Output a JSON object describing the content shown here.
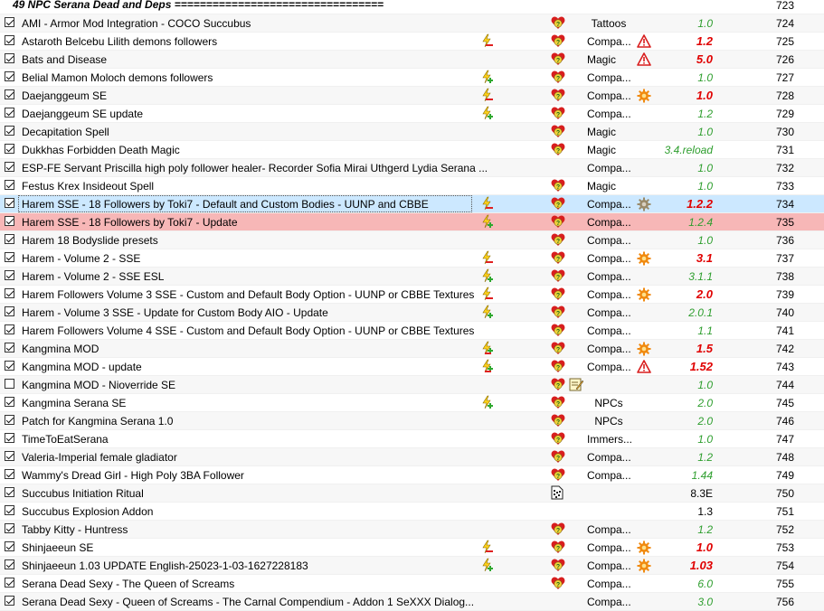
{
  "separator": {
    "label": "49 NPC Serana Dead and Deps =================================",
    "priority": "723"
  },
  "rows": [
    {
      "name": "AMI - Armor Mod Integration - COCO Succubus",
      "checked": true,
      "flag": "",
      "heart": true,
      "cat": "Tattoos",
      "catCenter": true,
      "warn": "",
      "ver": "1.0",
      "verStyle": "ok",
      "prio": "724"
    },
    {
      "name": "Astaroth Belcebu Lilith demons followers",
      "checked": true,
      "flag": "lightning-red",
      "heart": true,
      "cat": "Compa...",
      "warn": "warning",
      "ver": "1.2",
      "verStyle": "bad",
      "prio": "725"
    },
    {
      "name": "Bats and Disease",
      "checked": true,
      "flag": "",
      "heart": true,
      "cat": "Magic",
      "warn": "warning",
      "ver": "5.0",
      "verStyle": "bad",
      "prio": "726"
    },
    {
      "name": "Belial Mamon Moloch demons followers",
      "checked": true,
      "flag": "lightning-green",
      "heart": true,
      "cat": "Compa...",
      "warn": "",
      "ver": "1.0",
      "verStyle": "ok",
      "prio": "727"
    },
    {
      "name": "Daejanggeum SE",
      "checked": true,
      "flag": "lightning-red",
      "heart": true,
      "cat": "Compa...",
      "warn": "gear",
      "ver": "1.0",
      "verStyle": "bad",
      "prio": "728"
    },
    {
      "name": "Daejanggeum SE update",
      "checked": true,
      "flag": "lightning-green",
      "heart": true,
      "cat": "Compa...",
      "warn": "",
      "ver": "1.2",
      "verStyle": "ok",
      "prio": "729"
    },
    {
      "name": "Decapitation Spell",
      "checked": true,
      "flag": "",
      "heart": true,
      "cat": "Magic",
      "warn": "",
      "ver": "1.0",
      "verStyle": "ok",
      "prio": "730"
    },
    {
      "name": "Dukkhas Forbidden Death Magic",
      "checked": true,
      "flag": "",
      "heart": true,
      "cat": "Magic",
      "warn": "",
      "ver": "3.4.reload",
      "verStyle": "ok",
      "prio": "731"
    },
    {
      "name": "ESP-FE Servant Priscilla high poly follower healer- Recorder Sofia Mirai Uthgerd Lydia Serana ...",
      "checked": true,
      "flag": "",
      "heart": false,
      "cat": "Compa...",
      "warn": "",
      "ver": "1.0",
      "verStyle": "ok",
      "prio": "732"
    },
    {
      "name": "Festus Krex Insideout Spell",
      "checked": true,
      "flag": "",
      "heart": true,
      "cat": "Magic",
      "warn": "",
      "ver": "1.0",
      "verStyle": "ok",
      "prio": "733"
    },
    {
      "name": "Harem SSE - 18 Followers by Toki7 - Default and Custom Bodies - UUNP and CBBE",
      "checked": true,
      "flag": "lightning-red",
      "heart": true,
      "cat": "Compa...",
      "warn": "gear-gray",
      "ver": "1.2.2",
      "verStyle": "bad",
      "prio": "734",
      "state": "selected"
    },
    {
      "name": "Harem SSE - 18 Followers by Toki7 - Update",
      "checked": true,
      "flag": "lightning-green",
      "heart": true,
      "cat": "Compa...",
      "warn": "",
      "ver": "1.2.4",
      "verStyle": "ok",
      "prio": "735",
      "state": "conflict"
    },
    {
      "name": "Harem 18 Bodyslide presets",
      "checked": true,
      "flag": "",
      "heart": true,
      "cat": "Compa...",
      "warn": "",
      "ver": "1.0",
      "verStyle": "ok",
      "prio": "736"
    },
    {
      "name": "Harem - Volume 2 - SSE",
      "checked": true,
      "flag": "lightning-red",
      "heart": true,
      "cat": "Compa...",
      "warn": "gear",
      "ver": "3.1",
      "verStyle": "bad",
      "prio": "737"
    },
    {
      "name": "Harem - Volume 2 - SSE ESL",
      "checked": true,
      "flag": "lightning-green",
      "heart": true,
      "cat": "Compa...",
      "warn": "",
      "ver": "3.1.1",
      "verStyle": "ok",
      "prio": "738"
    },
    {
      "name": "Harem Followers Volume 3 SSE - Custom and Default Body Option - UUNP or CBBE Textures",
      "checked": true,
      "flag": "lightning-red",
      "heart": true,
      "cat": "Compa...",
      "warn": "gear",
      "ver": "2.0",
      "verStyle": "bad",
      "prio": "739"
    },
    {
      "name": "Harem - Volume 3 SSE - Update for Custom Body AIO - Update",
      "checked": true,
      "flag": "lightning-green",
      "heart": true,
      "cat": "Compa...",
      "warn": "",
      "ver": "2.0.1",
      "verStyle": "ok",
      "prio": "740"
    },
    {
      "name": "Harem Followers Volume 4 SSE - Custom and Default Body Option - UUNP or CBBE Textures",
      "checked": true,
      "flag": "",
      "heart": true,
      "cat": "Compa...",
      "warn": "",
      "ver": "1.1",
      "verStyle": "ok",
      "prio": "741"
    },
    {
      "name": "Kangmina MOD",
      "checked": true,
      "flag": "lightning-both",
      "heart": true,
      "cat": "Compa...",
      "warn": "gear",
      "ver": "1.5",
      "verStyle": "bad",
      "prio": "742"
    },
    {
      "name": "Kangmina MOD - update",
      "checked": true,
      "flag": "lightning-both",
      "heart": true,
      "cat": "Compa...",
      "warn": "warning",
      "ver": "1.52",
      "verStyle": "bad",
      "prio": "743"
    },
    {
      "name": "Kangmina MOD - Nioverride SE",
      "checked": false,
      "flag": "",
      "heart": true,
      "note": true,
      "cat": "",
      "warn": "",
      "ver": "1.0",
      "verStyle": "ok",
      "prio": "744"
    },
    {
      "name": "Kangmina Serana SE",
      "checked": true,
      "flag": "lightning-green",
      "heart": true,
      "cat": "NPCs",
      "catCenter": true,
      "warn": "",
      "ver": "2.0",
      "verStyle": "ok",
      "prio": "745"
    },
    {
      "name": "Patch for Kangmina Serana 1.0",
      "checked": true,
      "flag": "",
      "heart": true,
      "cat": "NPCs",
      "catCenter": true,
      "warn": "",
      "ver": "2.0",
      "verStyle": "ok",
      "prio": "746"
    },
    {
      "name": "TimeToEatSerana",
      "checked": true,
      "flag": "",
      "heart": true,
      "cat": "Immers...",
      "warn": "",
      "ver": "1.0",
      "verStyle": "ok",
      "prio": "747"
    },
    {
      "name": "Valeria-Imperial female gladiator",
      "checked": true,
      "flag": "",
      "heart": true,
      "cat": "Compa...",
      "warn": "",
      "ver": "1.2",
      "verStyle": "ok",
      "prio": "748"
    },
    {
      "name": "Wammy's Dread Girl - High Poly 3BA Follower",
      "checked": true,
      "flag": "",
      "heart": true,
      "cat": "Compa...",
      "warn": "",
      "ver": "1.44",
      "verStyle": "ok",
      "prio": "749"
    },
    {
      "name": "Succubus Initiation Ritual",
      "checked": true,
      "flag": "",
      "heart": false,
      "page": true,
      "cat": "",
      "warn": "",
      "ver": "8.3E",
      "verStyle": "plain",
      "prio": "750"
    },
    {
      "name": "Succubus Explosion Addon",
      "checked": true,
      "flag": "",
      "heart": false,
      "cat": "",
      "warn": "",
      "ver": "1.3",
      "verStyle": "plain",
      "prio": "751"
    },
    {
      "name": "Tabby Kitty - Huntress",
      "checked": true,
      "flag": "",
      "heart": true,
      "cat": "Compa...",
      "warn": "",
      "ver": "1.2",
      "verStyle": "ok",
      "prio": "752"
    },
    {
      "name": "Shinjaeeun SE",
      "checked": true,
      "flag": "lightning-red",
      "heart": true,
      "cat": "Compa...",
      "warn": "gear",
      "ver": "1.0",
      "verStyle": "bad",
      "prio": "753"
    },
    {
      "name": "Shinjaeeun 1.03 UPDATE English-25023-1-03-1627228183",
      "checked": true,
      "flag": "lightning-green",
      "heart": true,
      "cat": "Compa...",
      "warn": "gear",
      "ver": "1.03",
      "verStyle": "bad",
      "prio": "754"
    },
    {
      "name": "Serana Dead Sexy - The Queen of Screams",
      "checked": true,
      "flag": "",
      "heart": true,
      "cat": "Compa...",
      "warn": "",
      "ver": "6.0",
      "verStyle": "ok",
      "prio": "755"
    },
    {
      "name": "Serana Dead Sexy - Queen of Screams - The Carnal Compendium - Addon 1 SeXXX Dialog...",
      "checked": true,
      "flag": "",
      "heart": false,
      "cat": "Compa...",
      "warn": "",
      "ver": "3.0",
      "verStyle": "ok",
      "prio": "756"
    }
  ]
}
